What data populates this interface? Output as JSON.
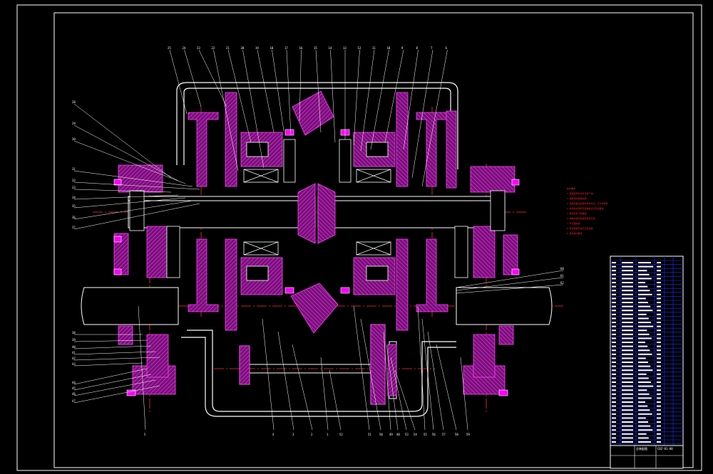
{
  "drawing": {
    "background": "#000000",
    "colors": {
      "frame": "#ffffff",
      "section": "#c020c0",
      "hatch": "#e040e0",
      "centerline": "#ff3030",
      "leader": "#ffffff",
      "table_blue": "#2030ff",
      "notes": "#ff2020",
      "bolt": "#ff00ff"
    },
    "callouts_top": [
      "25",
      "24",
      "23",
      "22",
      "21",
      "20",
      "19",
      "18",
      "17",
      "16",
      "15",
      "14",
      "13",
      "12",
      "11",
      "10",
      "9",
      "8",
      "7",
      "6"
    ],
    "callouts_left": [
      "28",
      "29",
      "30",
      "31",
      "32",
      "33",
      "34",
      "35",
      "36",
      "37",
      "38",
      "39",
      "40",
      "41",
      "42",
      "43",
      "44",
      "45",
      "46",
      "47"
    ],
    "callouts_bottom": [
      "5",
      "4",
      "3",
      "2",
      "1",
      "52",
      "51",
      "50",
      "49",
      "48",
      "53",
      "54",
      "55",
      "56",
      "57",
      "58",
      "59"
    ],
    "callouts_right": [
      "60",
      "61",
      "62"
    ]
  },
  "notes": {
    "lines": [
      "技术要求",
      "1.装配前所有零件清洗干净",
      "2.轴承用润滑脂润滑",
      "3.装配后各运动部件转动灵活，无卡滞现象",
      "4.齿轮啮合侧隙及接触斑点应符合要求",
      "5.各密封处不得漏油",
      "6.箱体内装润滑油至规定高度",
      "7.外表面涂漆",
      "8.按试验规范进行空载试验",
      "9.其余技术要求"
    ]
  },
  "title_block": {
    "drawing_name": "总装配图",
    "drawing_code": "CBZ-01-00"
  }
}
